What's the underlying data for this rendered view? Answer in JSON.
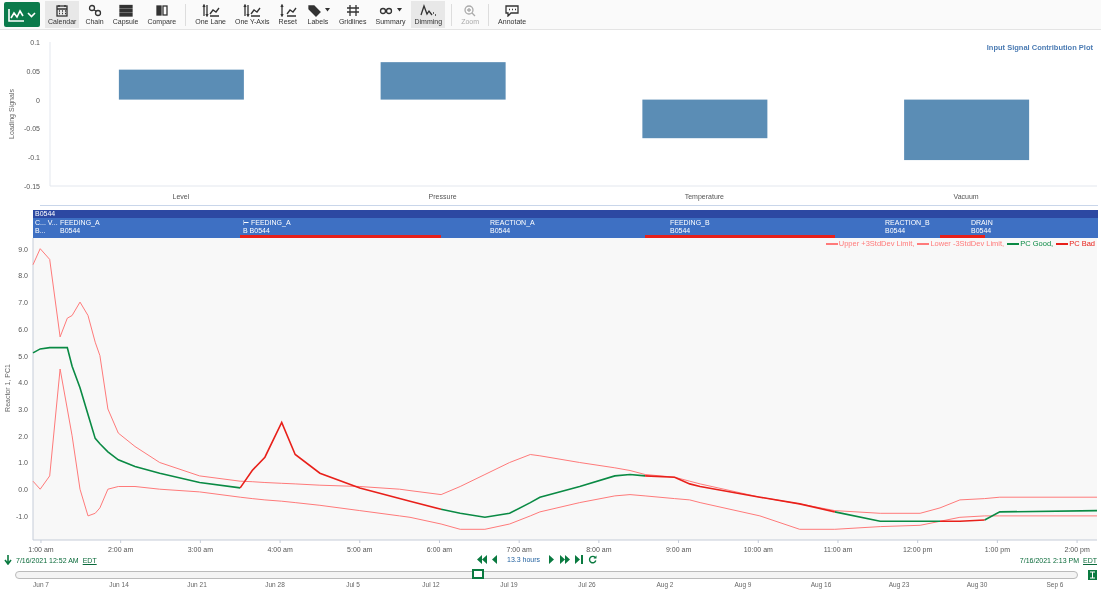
{
  "toolbar": {
    "groups": [
      [
        {
          "label": "Calendar",
          "selected": true,
          "disabled": false,
          "dropdown": false
        },
        {
          "label": "Chain",
          "selected": false,
          "disabled": false,
          "dropdown": false
        },
        {
          "label": "Capsule",
          "selected": false,
          "disabled": false,
          "dropdown": false
        },
        {
          "label": "Compare",
          "selected": false,
          "disabled": false,
          "dropdown": false
        }
      ],
      [
        {
          "label": "One Lane",
          "selected": false,
          "disabled": false,
          "dropdown": false
        },
        {
          "label": "One Y-Axis",
          "selected": false,
          "disabled": false,
          "dropdown": false
        },
        {
          "label": "Reset",
          "selected": false,
          "disabled": false,
          "dropdown": false
        },
        {
          "label": "Labels",
          "selected": false,
          "disabled": false,
          "dropdown": true
        },
        {
          "label": "Gridlines",
          "selected": false,
          "disabled": false,
          "dropdown": false
        },
        {
          "label": "Summary",
          "selected": false,
          "disabled": false,
          "dropdown": true
        },
        {
          "label": "Dimming",
          "selected": true,
          "disabled": false,
          "dropdown": false
        }
      ],
      [
        {
          "label": "Zoom",
          "selected": false,
          "disabled": true,
          "dropdown": false
        }
      ],
      [
        {
          "label": "Annotate",
          "selected": false,
          "disabled": false,
          "dropdown": false
        }
      ]
    ]
  },
  "contribution_plot": {
    "chart_data": {
      "type": "bar",
      "title": "Input Signal Contribution Plot",
      "ylabel": "Loading Signals",
      "categories": [
        "Level",
        "Pressure",
        "Temperature",
        "Vacuum"
      ],
      "values": [
        0.052,
        0.065,
        -0.067,
        -0.105
      ],
      "ylim": [
        -0.15,
        0.1
      ],
      "yticks": [
        {
          "value": 0.1,
          "label": "0.1"
        },
        {
          "value": 0.05,
          "label": "0.05"
        },
        {
          "value": 0,
          "label": "0"
        },
        {
          "value": -0.05,
          "label": "-0.05"
        },
        {
          "value": -0.1,
          "label": "-0.1"
        },
        {
          "value": -0.15,
          "label": "-0.15"
        }
      ]
    }
  },
  "capsule_lanes": {
    "header": "B0544",
    "row_labels": [
      "C... V...",
      "B..."
    ],
    "capsules": [
      {
        "label": "FEEDING_A",
        "batch": "B0544"
      },
      {
        "label": "⊢ FEEDING_A",
        "batch": "B B0544"
      },
      {
        "label": "REACTION_A",
        "batch": "B0544"
      },
      {
        "label": "FEEDING_B",
        "batch": "B0544"
      },
      {
        "label": "REACTION_B",
        "batch": "B0544"
      },
      {
        "label": "DRAIN",
        "batch": "B0544"
      }
    ]
  },
  "trend": {
    "chart_data": {
      "type": "line",
      "ylabel": "Reactor 1, PC1",
      "xlim": [
        0.9,
        14.25
      ],
      "ylim": [
        -1.9,
        9.4
      ],
      "x": [
        0.9,
        0.99,
        1.11,
        1.24,
        1.33,
        1.39,
        1.49,
        1.59,
        1.68,
        1.74,
        1.84,
        1.97,
        2.18,
        2.49,
        2.99,
        3.5,
        3.65,
        3.81,
        4.02,
        4.19,
        4.5,
        5.0,
        5.5,
        5.63,
        6.02,
        6.26,
        6.57,
        6.88,
        7.14,
        7.26,
        7.76,
        8.2,
        8.39,
        8.58,
        8.95,
        9.14,
        9.27,
        10.02,
        10.52,
        10.96,
        11.53,
        12.03,
        12.28,
        12.53,
        12.84,
        13.03,
        14.25
      ],
      "series": [
        {
          "name": "Upper +3StdDev Limit,",
          "color": "#ff7a7a",
          "values": [
            8.4,
            9.0,
            8.6,
            5.7,
            6.4,
            6.5,
            7.0,
            6.5,
            5.5,
            5.0,
            3.0,
            2.1,
            1.6,
            1.0,
            0.5,
            0.3,
            0.28,
            0.25,
            0.22,
            0.2,
            0.15,
            0.1,
            0.0,
            -0.05,
            -0.2,
            0.1,
            0.55,
            1.0,
            1.3,
            1.25,
            1.0,
            0.8,
            0.7,
            0.55,
            0.45,
            0.3,
            0.2,
            -0.3,
            -0.55,
            -0.8,
            -0.9,
            -0.9,
            -0.7,
            -0.4,
            -0.35,
            -0.3,
            -0.3
          ]
        },
        {
          "name": "Lower -3StdDev Limit,",
          "color": "#ff7a7a",
          "values": [
            0.3,
            0.0,
            0.5,
            4.5,
            3.0,
            2.0,
            0.0,
            -1.0,
            -0.9,
            -0.7,
            0.0,
            0.1,
            0.1,
            0.0,
            -0.1,
            -0.3,
            -0.35,
            -0.4,
            -0.45,
            -0.5,
            -0.6,
            -0.8,
            -1.0,
            -1.05,
            -1.3,
            -1.5,
            -1.5,
            -1.3,
            -1.0,
            -0.85,
            -0.5,
            -0.25,
            -0.2,
            -0.25,
            -0.35,
            -0.4,
            -0.5,
            -1.0,
            -1.5,
            -1.5,
            -1.4,
            -1.35,
            -1.2,
            -1.05,
            -1.0,
            -1.0,
            -1.0
          ]
        },
        {
          "name": "PC Good,",
          "color": "#0a8a44",
          "values": [
            5.1,
            5.25,
            5.3,
            5.3,
            5.3,
            4.6,
            3.8,
            2.8,
            1.9,
            1.7,
            1.4,
            1.1,
            0.85,
            0.6,
            0.25,
            0.05,
            null,
            null,
            null,
            null,
            null,
            null,
            null,
            null,
            -0.75,
            -0.9,
            -1.05,
            -0.9,
            -0.5,
            -0.3,
            0.1,
            0.5,
            0.55,
            0.5,
            null,
            null,
            null,
            null,
            null,
            -0.85,
            -1.2,
            -1.2,
            -1.2,
            null,
            -1.15,
            -0.85,
            -0.8
          ]
        },
        {
          "name": "PC Bad",
          "color": "#e8201a",
          "values": [
            null,
            null,
            null,
            null,
            null,
            null,
            null,
            null,
            null,
            null,
            null,
            null,
            null,
            null,
            null,
            0.05,
            0.7,
            1.2,
            2.5,
            1.3,
            0.6,
            0.05,
            -0.35,
            -0.45,
            -0.75,
            null,
            null,
            null,
            null,
            null,
            null,
            null,
            null,
            0.5,
            0.45,
            0.2,
            0.1,
            -0.3,
            -0.55,
            -0.85,
            null,
            null,
            -1.2,
            -1.2,
            -1.15,
            null,
            null
          ]
        }
      ],
      "xticks": [
        {
          "value": 1,
          "label": "1:00 am"
        },
        {
          "value": 2,
          "label": "2:00 am"
        },
        {
          "value": 3,
          "label": "3:00 am"
        },
        {
          "value": 4,
          "label": "4:00 am"
        },
        {
          "value": 5,
          "label": "5:00 am"
        },
        {
          "value": 6,
          "label": "6:00 am"
        },
        {
          "value": 7,
          "label": "7:00 am"
        },
        {
          "value": 8,
          "label": "8:00 am"
        },
        {
          "value": 9,
          "label": "9:00 am"
        },
        {
          "value": 10,
          "label": "10:00 am"
        },
        {
          "value": 11,
          "label": "11:00 am"
        },
        {
          "value": 12,
          "label": "12:00 pm"
        },
        {
          "value": 13,
          "label": "1:00 pm"
        },
        {
          "value": 14,
          "label": "2:00 pm"
        }
      ],
      "yticks": [
        {
          "value": 9,
          "label": "9.0"
        },
        {
          "value": 8,
          "label": "8.0"
        },
        {
          "value": 7,
          "label": "7.0"
        },
        {
          "value": 6,
          "label": "6.0"
        },
        {
          "value": 5,
          "label": "5.0"
        },
        {
          "value": 4,
          "label": "4.0"
        },
        {
          "value": 3,
          "label": "3.0"
        },
        {
          "value": 2,
          "label": "2.0"
        },
        {
          "value": 1,
          "label": "1.0"
        },
        {
          "value": 0,
          "label": "0.0"
        },
        {
          "value": -1,
          "label": "-1.0"
        }
      ]
    }
  },
  "range": {
    "start": "7/16/2021 12:52 AM",
    "start_zone": "EDT",
    "duration": "13.3 hours",
    "end": "7/16/2021 2:13 PM",
    "end_zone": "EDT"
  },
  "timeline": {
    "level": 0.435,
    "dates": [
      "Jun 7",
      "Jun 14",
      "Jun 21",
      "Jun 28",
      "Jul 5",
      "Jul 12",
      "Jul 19",
      "Jul 26",
      "Aug 2",
      "Aug 9",
      "Aug 16",
      "Aug 23",
      "Aug 30",
      "Sep 6"
    ]
  }
}
